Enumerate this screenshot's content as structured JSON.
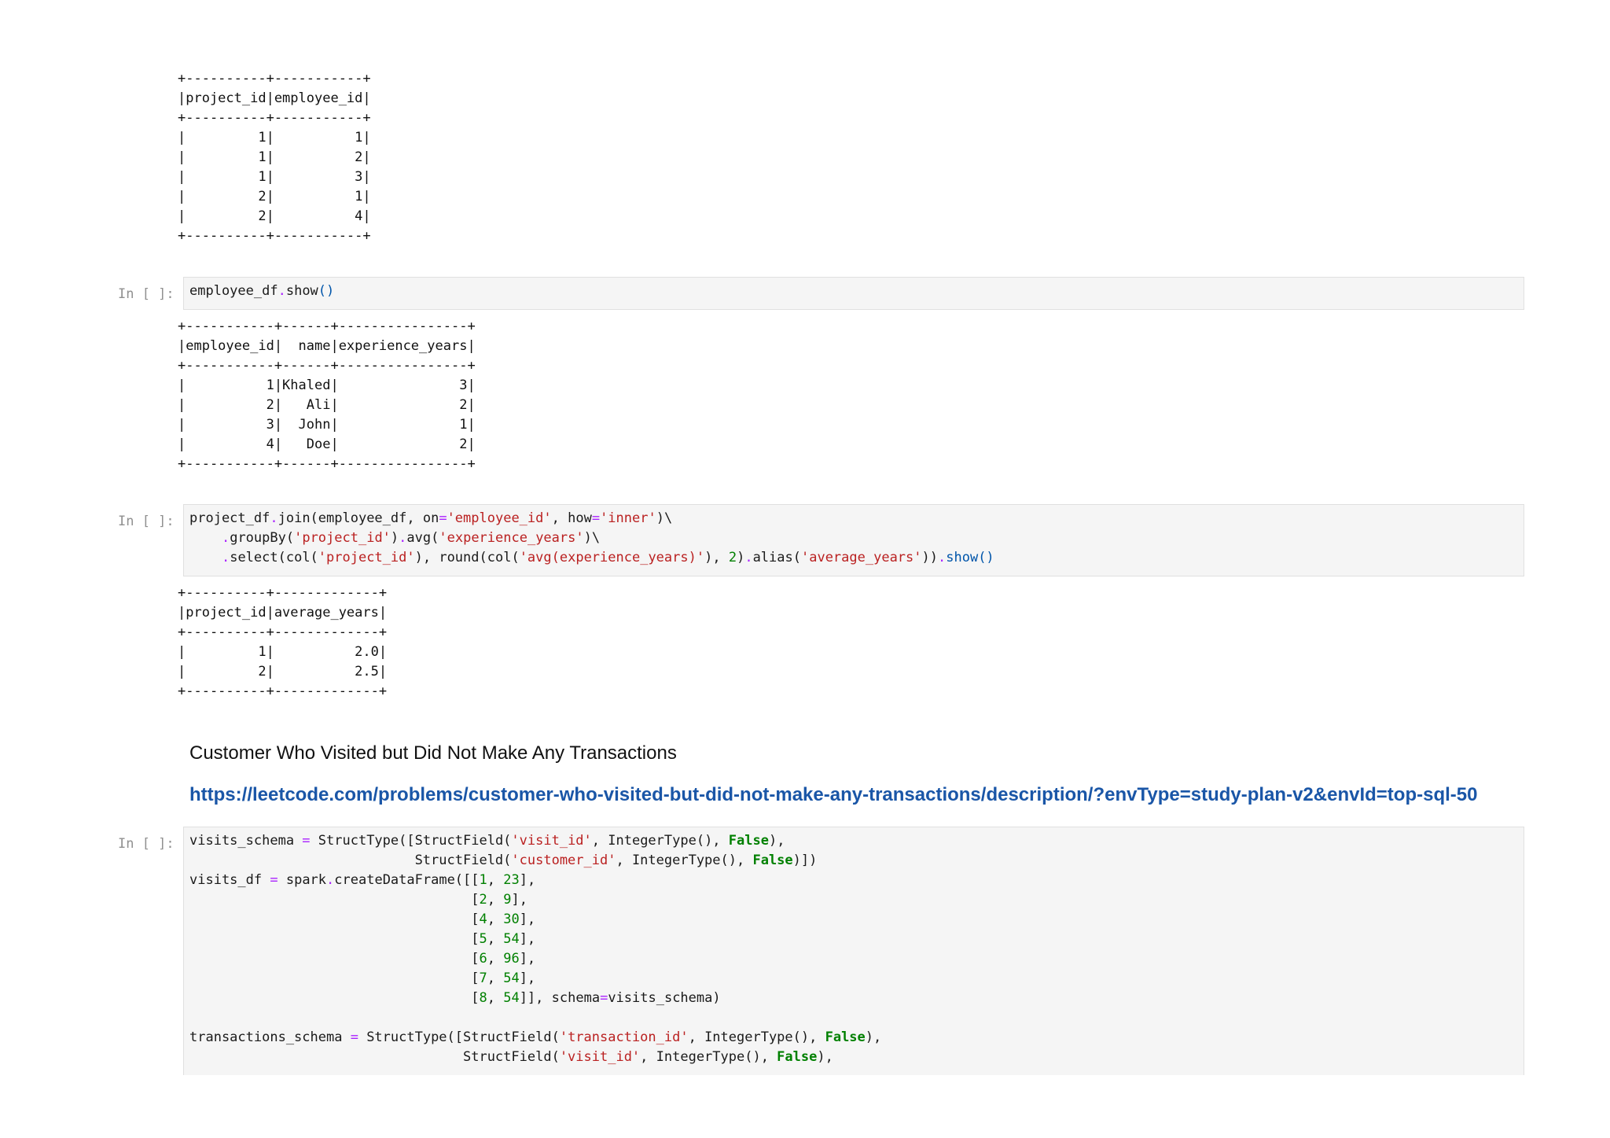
{
  "outputs": {
    "project_table": "+----------+-----------+\n|project_id|employee_id|\n+----------+-----------+\n|         1|          1|\n|         1|          2|\n|         1|          3|\n|         2|          1|\n|         2|          4|\n+----------+-----------+",
    "employee_table": "+-----------+------+----------------+\n|employee_id|  name|experience_years|\n+-----------+------+----------------+\n|          1|Khaled|               3|\n|          2|   Ali|               2|\n|          3|  John|               1|\n|          4|   Doe|               2|\n+-----------+------+----------------+",
    "average_table": "+----------+-------------+\n|project_id|average_years|\n+----------+-------------+\n|         1|          2.0|\n|         2|          2.5|\n+----------+-------------+"
  },
  "cells": {
    "prompt": "In [ ]:",
    "employee_show": {
      "obj": "employee_df",
      "method": "show",
      "parens": "()"
    },
    "join_cell": {
      "l1_a": "project_df",
      "l1_b": "join(employee_df, on",
      "l1_c": "'employee_id'",
      "l1_d": ", how",
      "l1_e": "'inner'",
      "l1_f": ")\\",
      "l2_a": "    ",
      "l2_b": "groupBy(",
      "l2_c": "'project_id'",
      "l2_d": ")",
      "l2_e": "avg(",
      "l2_f": "'experience_years'",
      "l2_g": ")\\",
      "l3_a": "    ",
      "l3_b": "select(col(",
      "l3_c": "'project_id'",
      "l3_d": "), round(col(",
      "l3_e": "'avg(experience_years)'",
      "l3_f": "), ",
      "l3_g": "2",
      "l3_h": ")",
      "l3_i": "alias(",
      "l3_j": "'average_years'",
      "l3_k": "))",
      "l3_l": "show()"
    },
    "visits_cell": {
      "v1_a": "visits_schema ",
      "v1_b": "=",
      "v1_c": " StructType([StructField(",
      "v1_d": "'visit_id'",
      "v1_e": ", IntegerType(), ",
      "v1_f": "False",
      "v1_g": "),",
      "v2_a": "                            StructField(",
      "v2_b": "'customer_id'",
      "v2_c": ", IntegerType(), ",
      "v2_d": "False",
      "v2_e": ")])",
      "v3_a": "visits_df ",
      "v3_b": "=",
      "v3_c": " spark",
      "v3_d": "createDataFrame([[",
      "rows": [
        [
          "1",
          "23"
        ],
        [
          "2",
          "9"
        ],
        [
          "4",
          "30"
        ],
        [
          "5",
          "54"
        ],
        [
          "6",
          "96"
        ],
        [
          "7",
          "54"
        ],
        [
          "8",
          "54"
        ]
      ],
      "schema_kw": "schema",
      "schema_val": "visits_schema)",
      "t1_a": "transactions_schema ",
      "t1_b": "=",
      "t1_c": " StructType([StructField(",
      "t1_d": "'transaction_id'",
      "t1_e": ", IntegerType(), ",
      "t1_f": "False",
      "t1_g": "),",
      "t2_a": "                                  StructField(",
      "t2_b": "'visit_id'",
      "t2_c": ", IntegerType(), ",
      "t2_d": "False",
      "t2_e": "),"
    }
  },
  "markdown": {
    "heading": "Customer Who Visited but Did Not Make Any Transactions",
    "link": "https://leetcode.com/problems/customer-who-visited-but-did-not-make-any-transactions/description/?envType=study-plan-v2&envId=top-sql-50"
  }
}
